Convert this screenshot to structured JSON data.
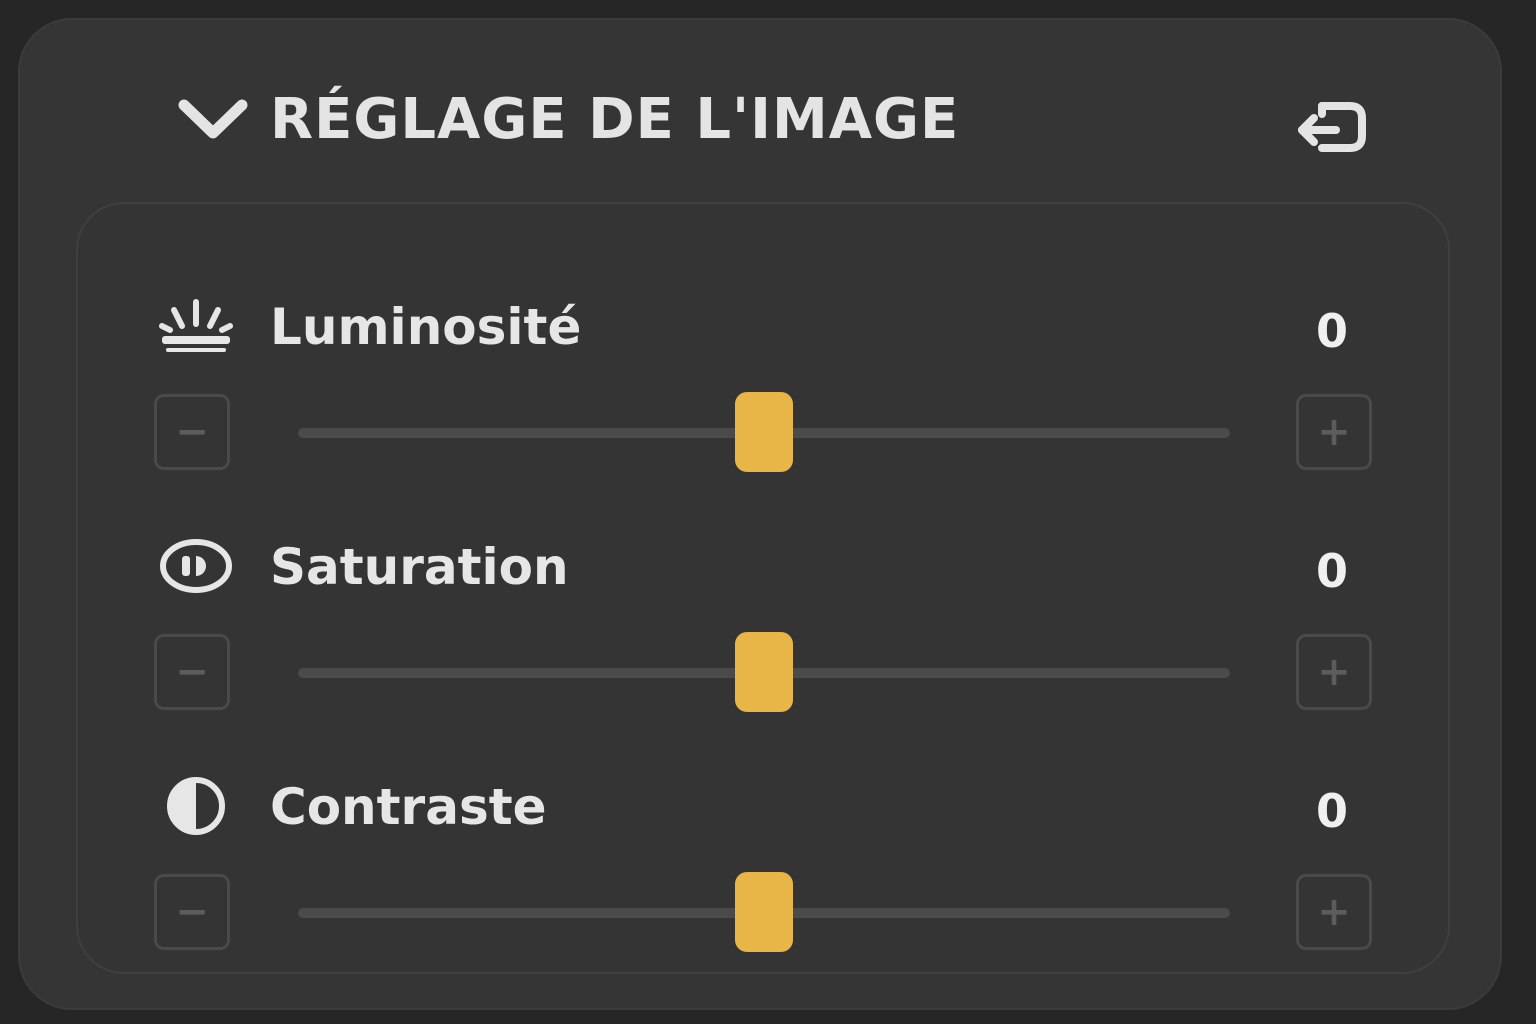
{
  "panel": {
    "title": "RÉGLAGE DE L'IMAGE",
    "collapse_icon": "chevron-down-icon",
    "reset_icon": "reset-icon"
  },
  "controls": [
    {
      "label": "Luminosité",
      "value": "0",
      "min": -100,
      "max": 100,
      "level": 0,
      "icon": "brightness-icon",
      "minus": "−",
      "plus": "+"
    },
    {
      "label": "Saturation",
      "value": "0",
      "min": -100,
      "max": 100,
      "level": 0,
      "icon": "saturation-icon",
      "minus": "−",
      "plus": "+"
    },
    {
      "label": "Contraste",
      "value": "0",
      "min": -100,
      "max": 100,
      "level": 0,
      "icon": "contrast-icon",
      "minus": "−",
      "plus": "+"
    }
  ],
  "colors": {
    "accent": "#e8b547",
    "background": "#262626",
    "panel": "#353535"
  }
}
